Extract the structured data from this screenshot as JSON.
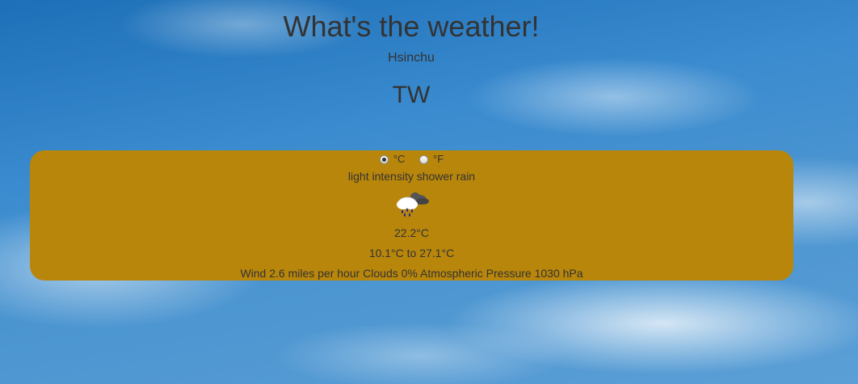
{
  "header": {
    "title": "What's the weather!",
    "city": "Hsinchu",
    "country": "TW"
  },
  "units": {
    "celsius_label": "°C",
    "fahrenheit_label": "°F",
    "selected": "celsius"
  },
  "weather": {
    "description": "light intensity shower rain",
    "icon": "shower-rain-icon",
    "temperature": "22.2°C",
    "range": "10.1°C to 27.1°C",
    "details": "Wind 2.6 miles per hour Clouds 0% Atmospheric Pressure 1030 hPa"
  },
  "colors": {
    "panel": "#b8860b",
    "sky": "#3a8bcf",
    "text": "#333333"
  }
}
